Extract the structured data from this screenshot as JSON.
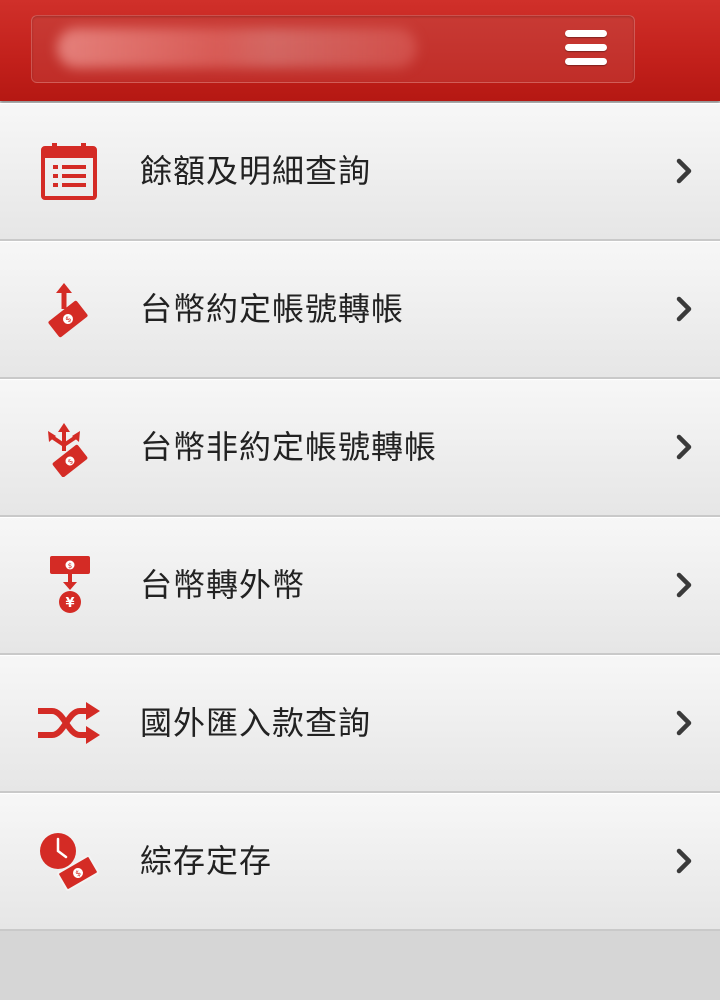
{
  "colors": {
    "brand_red": "#c62420",
    "icon_red": "#d42b25",
    "text": "#222222",
    "chevron": "#3a3a3a"
  },
  "header": {
    "menu_icon": "hamburger-menu-icon"
  },
  "menu": {
    "items": [
      {
        "label": "餘額及明細查詢",
        "icon": "calendar-list-icon"
      },
      {
        "label": "台幣約定帳號轉帳",
        "icon": "money-transfer-up-icon"
      },
      {
        "label": "台幣非約定帳號轉帳",
        "icon": "money-transfer-multi-arrow-icon"
      },
      {
        "label": "台幣轉外幣",
        "icon": "currency-exchange-yen-icon"
      },
      {
        "label": "國外匯入款查詢",
        "icon": "shuffle-arrows-icon"
      },
      {
        "label": "綜存定存",
        "icon": "clock-money-icon"
      }
    ]
  }
}
